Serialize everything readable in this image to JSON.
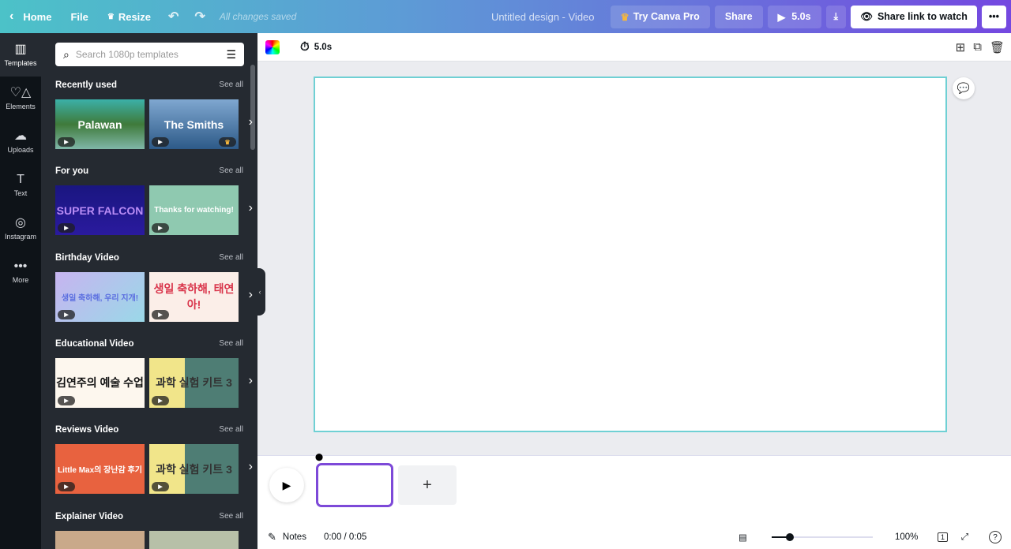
{
  "topbar": {
    "home": "Home",
    "file": "File",
    "resize": "Resize",
    "saved": "All changes saved",
    "title": "Untitled design - Video",
    "try_pro": "Try Canva Pro",
    "share": "Share",
    "play_duration": "5.0s",
    "share_link": "Share link to watch",
    "more": "•••"
  },
  "rail": [
    {
      "label": "Templates",
      "icon": "▥"
    },
    {
      "label": "Elements",
      "icon": "♡△"
    },
    {
      "label": "Uploads",
      "icon": "☁"
    },
    {
      "label": "Text",
      "icon": "T"
    },
    {
      "label": "Instagram",
      "icon": "◎"
    },
    {
      "label": "More",
      "icon": "•••"
    }
  ],
  "search": {
    "placeholder": "Search 1080p templates"
  },
  "see_all": "See all",
  "sections": [
    {
      "title": "Recently used",
      "thumbs": [
        {
          "text": "Palawan",
          "bg": "linear-gradient(180deg,#3bb0a8 0%,#3f7a3a 50%,#7fb7a8 100%)",
          "color": "#fff"
        },
        {
          "text": "The Smiths",
          "bg": "linear-gradient(180deg,#7fa7d0,#2d5a88)",
          "color": "#fff",
          "crown": true
        }
      ]
    },
    {
      "title": "For you",
      "thumbs": [
        {
          "text": "SUPER FALCON",
          "bg": "linear-gradient(180deg,#1a1680,#2a1a9e)",
          "color": "#b98cf5"
        },
        {
          "text": "Thanks for watching!",
          "bg": "#8fc9b0",
          "color": "#fff"
        }
      ]
    },
    {
      "title": "Birthday Video",
      "thumbs": [
        {
          "text": "생일 축하해, 우리 지개!",
          "bg": "linear-gradient(135deg,#c7b4f0,#9ad8e8)",
          "color": "#5b6ee0"
        },
        {
          "text": "생일 축하해, 태연아!",
          "bg": "#fbeee8",
          "color": "#d9344a"
        }
      ]
    },
    {
      "title": "Educational Video",
      "thumbs": [
        {
          "text": "김연주의 예술 수업",
          "bg": "#fdf7ee",
          "color": "#111"
        },
        {
          "text": "과학 실험 키트 3",
          "bg": "linear-gradient(90deg,#f1e58a 40%,#4e7d74 40%)",
          "color": "#333"
        }
      ]
    },
    {
      "title": "Reviews Video",
      "thumbs": [
        {
          "text": "Little Max의 장난감 후기",
          "bg": "#e8623f",
          "color": "#fff"
        },
        {
          "text": "과학 실험 키트 3",
          "bg": "linear-gradient(90deg,#f1e58a 40%,#4e7d74 40%)",
          "color": "#333"
        }
      ]
    },
    {
      "title": "Explainer Video",
      "thumbs": [
        {
          "text": "",
          "bg": "#c9a98a",
          "color": "#fff"
        },
        {
          "text": "",
          "bg": "#b7c0a8",
          "color": "#fff"
        }
      ]
    }
  ],
  "toolbar": {
    "duration": "5.0s"
  },
  "bottom": {
    "notes": "Notes",
    "time": "0:00 / 0:05",
    "zoom": "100%",
    "page_count": "1"
  },
  "colors": {
    "accent": "#7d49d8",
    "canvas_border": "#6fd0d4",
    "panel": "#252a31",
    "rail": "#0e1318"
  }
}
